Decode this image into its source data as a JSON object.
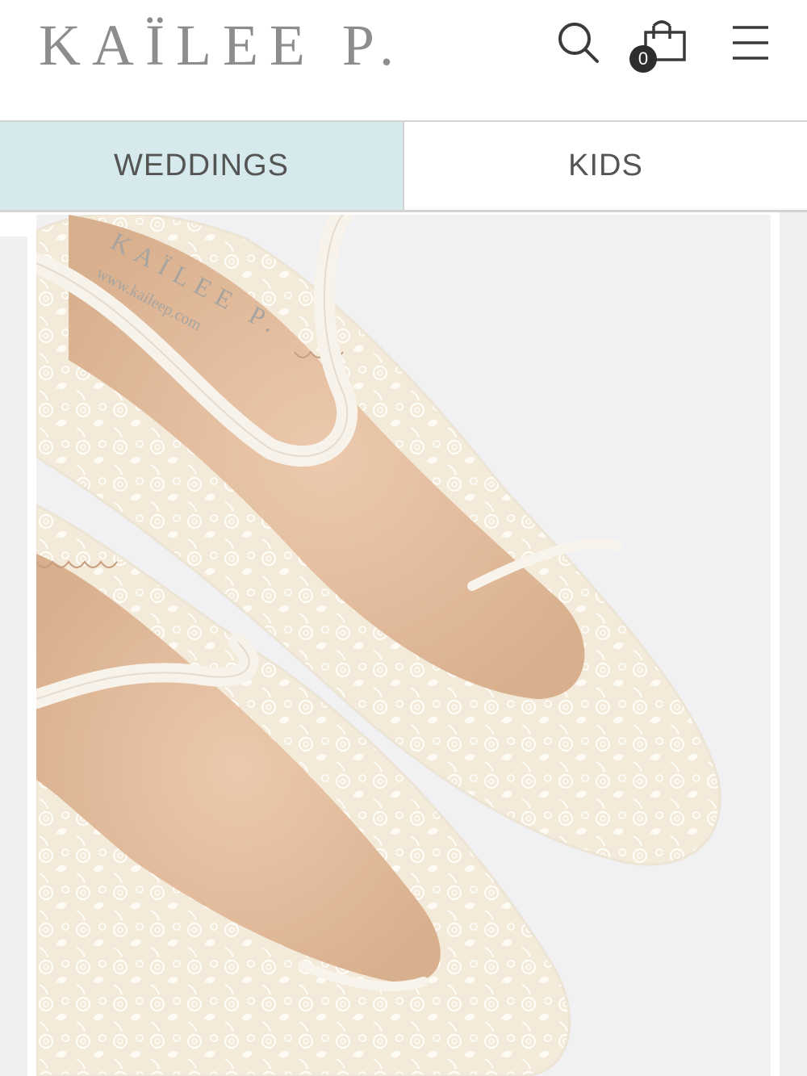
{
  "brand": {
    "logo_text": "KAÏLEE P."
  },
  "header": {
    "cart_count": "0",
    "icons": [
      "search-icon",
      "shopping-bag-icon",
      "hamburger-menu-icon"
    ]
  },
  "tabs": [
    {
      "label": "WEDDINGS",
      "active": true
    },
    {
      "label": "KIDS",
      "active": false
    }
  ],
  "product_image": {
    "insole_brand": "KAÏLEE P.",
    "insole_url": "www.kaileep.com"
  },
  "colors": {
    "logo": "#8e8c8e",
    "active_tab": "#d6e9ec",
    "tab_text": "#555555",
    "badge": "#2d2d2d",
    "image_bg": "#f1f1f3",
    "insole": "#e7c3a5",
    "lace": "#faf6ee"
  }
}
